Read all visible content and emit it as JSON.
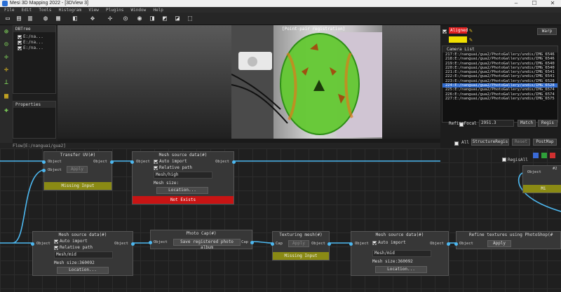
{
  "window": {
    "title": "Mesi 3D Mapping 2022 - [3DView 3]",
    "min": "–",
    "max": "☐",
    "close": "✕"
  },
  "menu": [
    "File",
    "Edit",
    "Tools",
    "Histogram",
    "View",
    "Plugins",
    "Window",
    "Help"
  ],
  "database": {
    "title": "DBTree",
    "items": [
      "E:/na...",
      "E:/na...",
      "E:/na..."
    ]
  },
  "properties": {
    "title": "Properties"
  },
  "viewport": {
    "label": "[Point-pair registration]"
  },
  "align": {
    "aligned_label": "Aligned",
    "aligned_color": "#e02020",
    "ref_color": "#f0e000",
    "warp_label": "Warp"
  },
  "camera_list": {
    "title": "Camera List",
    "rows": [
      "217:E:/nanguai/gua2/PhotoGallery/undis/IMG_6546",
      "218:E:/nanguai/gua2/PhotoGallery/undis/IMG_6546",
      "219:E:/nanguai/gua2/PhotoGallery/undis/IMG_6540",
      "220:E:/nanguai/gua2/PhotoGallery/undis/IMG_6540",
      "221:E:/nanguai/gua2/PhotoGallery/undis/IMG_6541",
      "222:E:/nanguai/gua2/PhotoGallery/undis/IMG_6541",
      "223:E:/nanguai/gua2/PhotoGallery/undis/IMG_6528",
      "224:E:/nanguai/gua2/PhotoGallery/undis/IMG_6528",
      "225:E:/nanguai/gua2/PhotoGallery/undis/IMG_6574",
      "226:E:/nanguai/gua2/PhotoGallery/undis/IMG_6574",
      "227:E:/nanguai/gua2/PhotoGallery/undis/IMG_6575"
    ],
    "selected_index": 7
  },
  "refine": {
    "label": "RefineFocal",
    "value": "2951.3",
    "match_label": "Match",
    "regis_label": "Regis"
  },
  "bottom_controls": {
    "all_label": "All",
    "structure_label": "StructureRegis",
    "reset_label": "Reset",
    "postmap_label": "PostMap"
  },
  "flow": {
    "path": "Flow[E:/nanguai/gua2]",
    "regisall_label": "RegisAll",
    "nodes": {
      "transfer": {
        "title": "Transfer UV(#)",
        "in": "Object",
        "out": "Object",
        "in2": "Object",
        "apply": "Apply",
        "status": "Missing Input",
        "status_color": "#8a8a14"
      },
      "mesh_top": {
        "title": "Mesh source data(#)",
        "in": "Object",
        "out": "Object",
        "auto": "Auto import",
        "rel": "Relative path",
        "mesh": "Mesh/high",
        "size": "Mesh size:",
        "loc": "Location...",
        "status": "Not Exists",
        "status_color": "#c81414"
      },
      "mesh_left": {
        "title": "Mesh source data(#)",
        "in": "Object",
        "out": "Object",
        "auto": "Auto import",
        "rel": "Relative path",
        "mesh": "Mesh/mid",
        "size": "Mesh size:360092",
        "loc": "Location..."
      },
      "photo_cap": {
        "title": "Photo Cap(#)",
        "in": "Object",
        "out": "Cap",
        "btn": "Save registered photo album"
      },
      "texturing": {
        "title": "Texturing mesh(#)",
        "in": "Cap",
        "out": "Object",
        "apply": "Apply",
        "status": "Missing Input",
        "status_color": "#8a8a14"
      },
      "mesh_right": {
        "title": "Mesh source data(#)",
        "in": "Object",
        "out": "Object",
        "auto": "Auto import",
        "mesh": "Mesh/mid",
        "size": "Mesh size:360092",
        "loc": "Location..."
      },
      "refine_tex": {
        "title": "Refine textures using PhotoShop(#",
        "in": "Object",
        "apply": "Apply"
      },
      "partial": {
        "in": "Object",
        "hdr": "#2",
        "status": "Mi"
      }
    }
  }
}
